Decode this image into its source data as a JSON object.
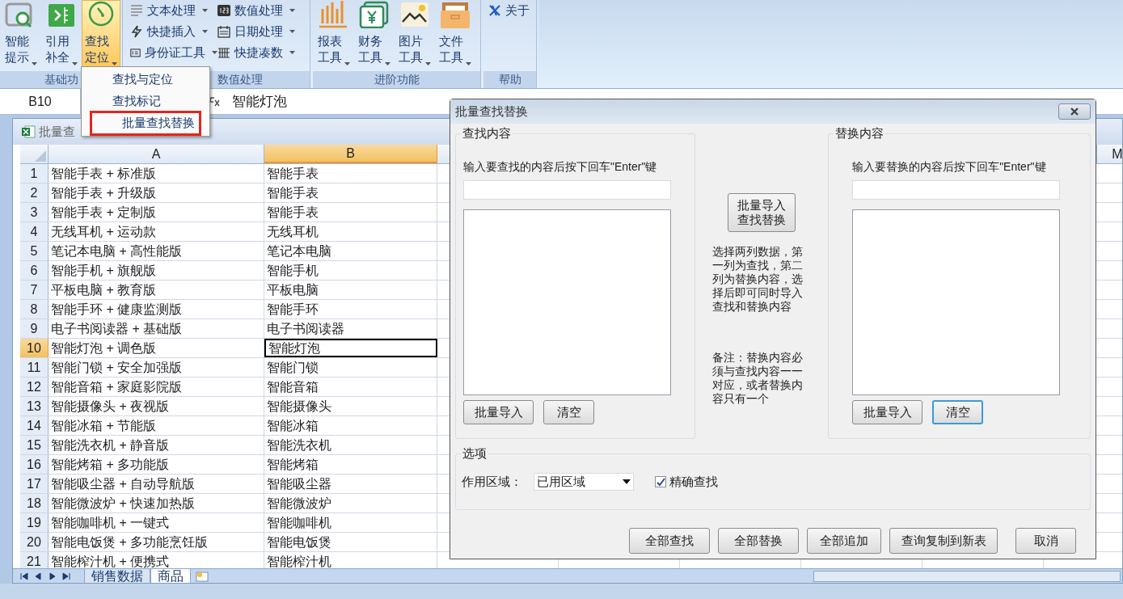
{
  "ribbon": {
    "groups": [
      {
        "label": "基础功",
        "large_buttons": [
          {
            "label": "智能提示",
            "selected": false
          },
          {
            "label": "引用补全",
            "selected": false
          },
          {
            "label": "查找定位",
            "selected": true
          }
        ]
      },
      {
        "label": "数值处理",
        "small_buttons": [
          {
            "label": "文本处理"
          },
          {
            "label": "数值处理"
          },
          {
            "label": "快捷插入"
          },
          {
            "label": "日期处理"
          },
          {
            "label": "身份证工具"
          },
          {
            "label": "快捷凑数"
          }
        ]
      },
      {
        "label": "进阶功能",
        "large_buttons": [
          {
            "label": "报表工具",
            "selected": false
          },
          {
            "label": "财务工具",
            "selected": false
          },
          {
            "label": "图片工具",
            "selected": false
          },
          {
            "label": "文件工具",
            "selected": false
          }
        ]
      },
      {
        "label": "帮助",
        "small_buttons": [
          {
            "label": "关于"
          }
        ]
      }
    ]
  },
  "dropdown_menu": {
    "items": [
      {
        "label": "查找与定位",
        "selected": false
      },
      {
        "label": "查找标记",
        "selected": false
      },
      {
        "label": "批量查找替换",
        "selected": true
      }
    ]
  },
  "formula_bar": {
    "name_box": "B10",
    "formula": "智能灯泡"
  },
  "workbook": {
    "title": "批量查",
    "columns": [
      {
        "label": "A",
        "selected": false
      },
      {
        "label": "B",
        "selected": true
      }
    ],
    "far_column": "M",
    "rows": [
      {
        "number": "1",
        "a": "智能手表 + 标准版",
        "b": "智能手表",
        "selected": false
      },
      {
        "number": "2",
        "a": "智能手表 + 升级版",
        "b": "智能手表",
        "selected": false
      },
      {
        "number": "3",
        "a": "智能手表 + 定制版",
        "b": "智能手表",
        "selected": false
      },
      {
        "number": "4",
        "a": "无线耳机 + 运动款",
        "b": "无线耳机",
        "selected": false
      },
      {
        "number": "5",
        "a": "笔记本电脑 + 高性能版",
        "b": "笔记本电脑",
        "selected": false
      },
      {
        "number": "6",
        "a": "智能手机 + 旗舰版",
        "b": "智能手机",
        "selected": false
      },
      {
        "number": "7",
        "a": "平板电脑 + 教育版",
        "b": "平板电脑",
        "selected": false
      },
      {
        "number": "8",
        "a": "智能手环 + 健康监测版",
        "b": "智能手环",
        "selected": false
      },
      {
        "number": "9",
        "a": "电子书阅读器 + 基础版",
        "b": "电子书阅读器",
        "selected": false
      },
      {
        "number": "10",
        "a": "智能灯泡 + 调色版",
        "b": "智能灯泡",
        "selected": true
      },
      {
        "number": "11",
        "a": "智能门锁 + 安全加强版",
        "b": "智能门锁",
        "selected": false
      },
      {
        "number": "12",
        "a": "智能音箱 + 家庭影院版",
        "b": "智能音箱",
        "selected": false
      },
      {
        "number": "13",
        "a": "智能摄像头 + 夜视版",
        "b": "智能摄像头",
        "selected": false
      },
      {
        "number": "14",
        "a": "智能冰箱 + 节能版",
        "b": "智能冰箱",
        "selected": false
      },
      {
        "number": "15",
        "a": "智能洗衣机 + 静音版",
        "b": "智能洗衣机",
        "selected": false
      },
      {
        "number": "16",
        "a": "智能烤箱 + 多功能版",
        "b": "智能烤箱",
        "selected": false
      },
      {
        "number": "17",
        "a": "智能吸尘器 + 自动导航版",
        "b": "智能吸尘器",
        "selected": false
      },
      {
        "number": "18",
        "a": "智能微波炉 + 快速加热版",
        "b": "智能微波炉",
        "selected": false
      },
      {
        "number": "19",
        "a": "智能咖啡机 + 一键式",
        "b": "智能咖啡机",
        "selected": false
      },
      {
        "number": "20",
        "a": "智能电饭煲 + 多功能烹饪版",
        "b": "智能电饭煲",
        "selected": false
      },
      {
        "number": "21",
        "a": "智能榨汁机 + 便携式",
        "b": "智能榨汁机",
        "selected": false
      }
    ],
    "sheet_tabs": [
      {
        "label": "销售数据",
        "selected": false
      },
      {
        "label": "商品",
        "selected": true
      }
    ]
  },
  "dialog": {
    "title": "批量查找替换",
    "find": {
      "legend": "查找内容",
      "hint": "输入要查找的内容后按下回车\"Enter\"键",
      "buttons": [
        {
          "label": "批量导入",
          "focused": false
        },
        {
          "label": "清空",
          "focused": false
        }
      ]
    },
    "middle": {
      "button": "批量导入查找替换",
      "note": "选择两列数据，第一列为查找，第二列为替换内容，选择后即可同时导入查找和替换内容",
      "remark": "备注：替换内容必须与查找内容一一对应，或者替换内容只有一个"
    },
    "replace": {
      "legend": "替换内容",
      "hint": "输入要替换的内容后按下回车\"Enter\"键",
      "buttons": [
        {
          "label": "批量导入",
          "focused": false
        },
        {
          "label": "清空",
          "focused": true
        }
      ]
    },
    "options": {
      "legend": "选项",
      "scope_label": "作用区域：",
      "scope_value": "已用区域",
      "exact": {
        "label": "精确查找",
        "checked": true
      }
    },
    "actions": [
      "全部查找",
      "全部替换",
      "全部追加",
      "查询复制到新表",
      "取消"
    ]
  }
}
